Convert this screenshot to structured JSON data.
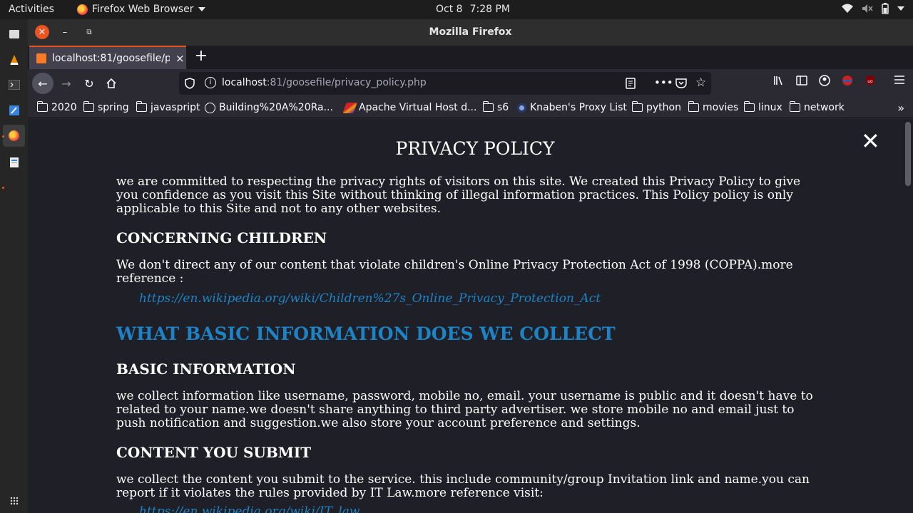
{
  "system": {
    "activities": "Activities",
    "app_name": "Firefox Web Browser",
    "date": "Oct 8",
    "time": "7:28 PM"
  },
  "window": {
    "title": "Mozilla Firefox"
  },
  "tab": {
    "label": "localhost:81/goosefile/p",
    "close": "×"
  },
  "address_bar": {
    "host": "localhost",
    "rest": ":81/goosefile/privacy_policy.php"
  },
  "bookmarks": [
    {
      "label": "2020",
      "icon": "folder-icon"
    },
    {
      "label": "spring",
      "icon": "folder-icon"
    },
    {
      "label": "javaspript",
      "icon": "folder-icon"
    },
    {
      "label": "Building%20A%20Ra...",
      "icon": "globe-icon"
    },
    {
      "label": "Apache Virtual Host d...",
      "icon": "apache-icon"
    },
    {
      "label": "s6",
      "icon": "folder-icon"
    },
    {
      "label": "Knaben's Proxy List",
      "icon": "knaben-icon"
    },
    {
      "label": "python",
      "icon": "folder-icon"
    },
    {
      "label": "movies",
      "icon": "folder-icon"
    },
    {
      "label": "linux",
      "icon": "folder-icon"
    },
    {
      "label": "network",
      "icon": "folder-icon"
    }
  ],
  "page": {
    "title": "PRIVACY POLICY",
    "intro": "we are committed to respecting the privacy rights of visitors on this site. We created this Privacy Policy to give you confidence as you visit this Site without thinking of illegal information practices. This Policy policy is only applicable to this Site and not to any other websites.",
    "children_heading": "CONCERNING CHILDREN",
    "children_text": "We don't direct any of our content that violate children's Online Privacy Protection Act of 1998 (COPPA).more reference :",
    "children_link": "https://en.wikipedia.org/wiki/Children%27s_Online_Privacy_Protection_Act",
    "collect_heading": "WHAT BASIC INFORMATION DOES WE COLLECT",
    "basic_heading": "BASIC INFORMATION",
    "basic_text": "we collect information like username, password, mobile no, email. your username is public and it doesn't have to related to your name.we doesn't share anything to third party advertiser. we store mobile no and email just to push notification and suggestion.we also store your account preference and settings.",
    "content_heading": "CONTENT YOU SUBMIT",
    "content_text": "we collect the content you submit to the service. this include community/group Invitation link and name.you can report if it violates the rules provided by IT Law.more reference visit:",
    "content_link": "https://en.wikipedia.org/wiki/IT_law"
  },
  "colors": {
    "accent": "#e95420",
    "link": "#1e83c4",
    "page_bg": "#1f1f28"
  }
}
